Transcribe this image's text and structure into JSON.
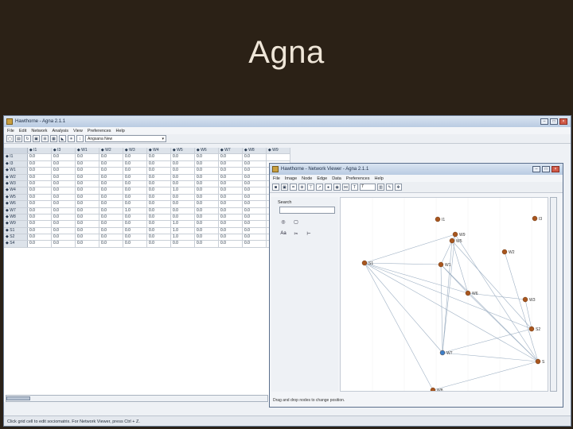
{
  "slide": {
    "title": "Agna"
  },
  "main_window": {
    "title": "Hawthorne - Agna 2.1.1",
    "menu": [
      "File",
      "Edit",
      "Network",
      "Analysis",
      "View",
      "Preferences",
      "Help"
    ],
    "combo_value": "Angsana New",
    "grid": {
      "columns": [
        "I1",
        "I3",
        "W1",
        "W2",
        "W3",
        "W4",
        "W5",
        "W6",
        "W7",
        "W8",
        "W9"
      ],
      "rows": [
        {
          "label": "I1",
          "values": [
            "0.0",
            "0.0",
            "0.0",
            "0.0",
            "0.0",
            "0.0",
            "0.0",
            "0.0",
            "0.0",
            "0.0"
          ]
        },
        {
          "label": "I3",
          "values": [
            "0.0",
            "0.0",
            "0.0",
            "0.0",
            "0.0",
            "0.0",
            "0.0",
            "0.0",
            "0.0",
            "0.0"
          ]
        },
        {
          "label": "W1",
          "values": [
            "0.0",
            "0.0",
            "0.0",
            "0.0",
            "0.0",
            "0.0",
            "0.0",
            "0.0",
            "0.0",
            "0.0"
          ]
        },
        {
          "label": "W2",
          "values": [
            "0.0",
            "0.0",
            "0.0",
            "0.0",
            "0.0",
            "0.0",
            "0.0",
            "0.0",
            "0.0",
            "0.0"
          ]
        },
        {
          "label": "W3",
          "values": [
            "0.0",
            "0.0",
            "0.0",
            "0.0",
            "0.0",
            "0.0",
            "0.0",
            "0.0",
            "0.0",
            "0.0"
          ]
        },
        {
          "label": "W4",
          "values": [
            "0.0",
            "0.0",
            "0.0",
            "0.0",
            "0.0",
            "0.0",
            "1.0",
            "0.0",
            "0.0",
            "0.0"
          ]
        },
        {
          "label": "W5",
          "values": [
            "0.0",
            "0.0",
            "0.0",
            "0.0",
            "0.0",
            "0.0",
            "0.0",
            "0.0",
            "0.0",
            "0.0"
          ]
        },
        {
          "label": "W6",
          "values": [
            "0.0",
            "0.0",
            "0.0",
            "0.0",
            "0.0",
            "0.0",
            "0.0",
            "0.0",
            "0.0",
            "0.0"
          ]
        },
        {
          "label": "W7",
          "values": [
            "0.0",
            "0.0",
            "0.0",
            "0.0",
            "1.0",
            "0.0",
            "0.0",
            "0.0",
            "0.0",
            "0.0"
          ]
        },
        {
          "label": "W8",
          "values": [
            "0.0",
            "0.0",
            "0.0",
            "0.0",
            "0.0",
            "0.0",
            "0.0",
            "0.0",
            "0.0",
            "0.0"
          ]
        },
        {
          "label": "W9",
          "values": [
            "0.0",
            "0.0",
            "0.0",
            "0.0",
            "0.0",
            "0.0",
            "1.0",
            "0.0",
            "0.0",
            "0.0"
          ]
        },
        {
          "label": "S1",
          "values": [
            "0.0",
            "0.0",
            "0.0",
            "0.0",
            "0.0",
            "0.0",
            "1.0",
            "0.0",
            "0.0",
            "0.0"
          ]
        },
        {
          "label": "S2",
          "values": [
            "0.0",
            "0.0",
            "0.0",
            "0.0",
            "0.0",
            "0.0",
            "1.0",
            "0.0",
            "0.0",
            "0.0"
          ]
        },
        {
          "label": "S4",
          "values": [
            "0.0",
            "0.0",
            "0.0",
            "0.0",
            "0.0",
            "0.0",
            "0.0",
            "0.0",
            "0.0",
            "0.0"
          ]
        }
      ]
    },
    "status": "Click grid cell to edit sociomatrix. For Network Viewer, press Ctrl + Z."
  },
  "network_viewer": {
    "title": "Hawthorne - Network Viewer - Agna 2.1.1",
    "menu": [
      "File",
      "Image",
      "Node",
      "Edge",
      "Data",
      "Preferences",
      "Help"
    ],
    "search_label": "Search",
    "search_value": "",
    "status": "Drag and drop nodes to change position.",
    "zoom_value": "7",
    "nodes": [
      {
        "label": "I1"
      },
      {
        "label": "I3"
      },
      {
        "label": "W9"
      },
      {
        "label": "W5"
      },
      {
        "label": "W2"
      },
      {
        "label": "S1"
      },
      {
        "label": "W1"
      },
      {
        "label": "W6"
      },
      {
        "label": "W3"
      },
      {
        "label": "S2"
      },
      {
        "label": "W7"
      },
      {
        "label": "S"
      },
      {
        "label": "W8"
      }
    ]
  }
}
